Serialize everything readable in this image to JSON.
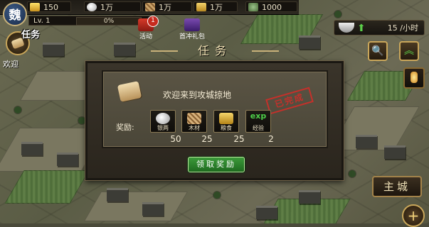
{
  "kingdom": "魏",
  "resources": {
    "gold": "150",
    "silver": "1万",
    "wood": "1万",
    "food": "1万",
    "population": "1000"
  },
  "level": {
    "label": "Lv. 1",
    "xp_percent": "0%"
  },
  "events": [
    {
      "label": "活动",
      "badge": "1"
    },
    {
      "label": "首冲礼包"
    }
  ],
  "rate": {
    "value": "15",
    "unit": "/小时"
  },
  "quest_icon": {
    "title": "任务",
    "caption": "欢迎"
  },
  "dialog": {
    "title": "任务",
    "message": "欢迎来到攻城掠地",
    "stamp": "已完成",
    "reward_label": "奖励:",
    "rewards": [
      {
        "name": "银两",
        "value": "50",
        "icon": "silver-ingot-icon"
      },
      {
        "name": "木材",
        "value": "25",
        "icon": "wood-icon"
      },
      {
        "name": "粮食",
        "value": "25",
        "icon": "grain-icon"
      },
      {
        "name": "经验",
        "value": "2",
        "icon": "exp-icon",
        "badge": "exp"
      }
    ],
    "claim_button": "领取奖励"
  },
  "main_city_button": "主城",
  "plus_button": "+"
}
